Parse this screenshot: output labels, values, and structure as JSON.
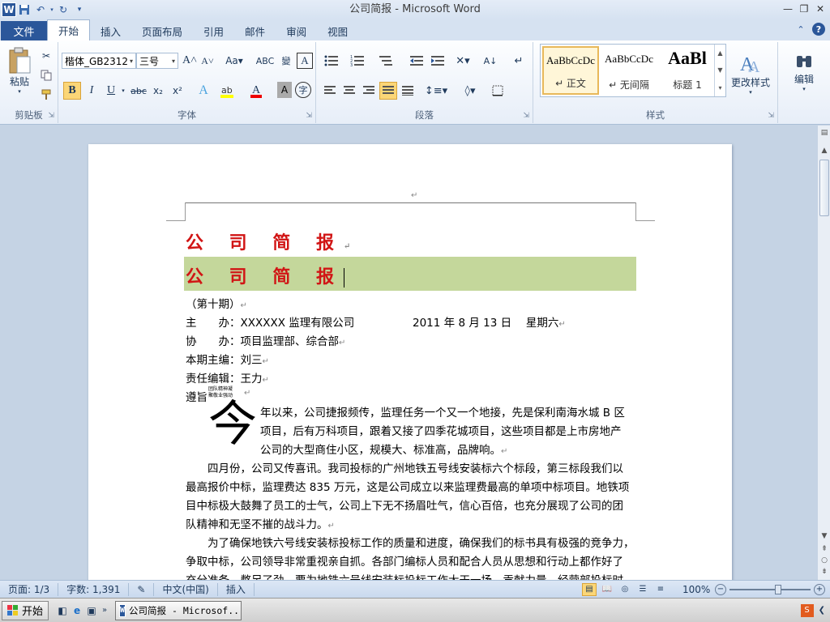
{
  "window": {
    "title": "公司简报 - Microsoft Word"
  },
  "qat": {
    "word_icon_letter": "W"
  },
  "tabs": [
    {
      "label": "文件"
    },
    {
      "label": "开始"
    },
    {
      "label": "插入"
    },
    {
      "label": "页面布局"
    },
    {
      "label": "引用"
    },
    {
      "label": "邮件"
    },
    {
      "label": "审阅"
    },
    {
      "label": "视图"
    }
  ],
  "ribbon": {
    "clipboard": {
      "paste": "粘贴",
      "label": "剪贴板"
    },
    "font": {
      "name": "楷体_GB2312",
      "size": "三号",
      "label": "字体"
    },
    "paragraph": {
      "label": "段落"
    },
    "styles": {
      "label": "样式",
      "items": [
        {
          "sample": "AaBbCcDc",
          "name": "↵ 正文"
        },
        {
          "sample": "AaBbCcDc",
          "name": "↵ 无间隔"
        },
        {
          "sample": "AaBl",
          "name": "标题 1"
        }
      ],
      "change": "更改样式"
    },
    "editing": {
      "label": "编辑"
    }
  },
  "document": {
    "title1": "公 司 简 报",
    "title2": "公 司 简 报",
    "issue": "（第十期）",
    "sponsor_label": "主　　办：",
    "sponsor": "XXXXXX 监理有限公司",
    "date": "2011 年 8 月  13 日",
    "weekday": "星期六",
    "co_label": "协　　办：",
    "co": "项目监理部、综合部",
    "chief_label": "本期主编：",
    "chief": "刘三",
    "editor_label": "责任编辑：",
    "editor": "王力",
    "motto_label": "遵旨",
    "motto_line1": "团队精神凝",
    "motto_line2": "聚敬业强动",
    "dropcap": "今",
    "p1_lines": [
      "年以来，公司捷报频传，监理任务一个又一个地接，先是保利南海水城 B 区",
      "项目，后有万科项目，跟着又接了四季花城项目，这些项目都是上市房地产",
      "公司的大型商住小区，规模大、标准高，品牌响。"
    ],
    "p2_lines": [
      "　　四月份，公司又传喜讯。我司投标的广州地铁五号线安装标六个标段，第三标段我们以",
      "最高报价中标，监理费达 835 万元，这是公司成立以来监理费最高的单项中标项目。地铁项",
      "目中标极大鼓舞了员工的士气，公司上下无不扬眉吐气，信心百倍，也充分展现了公司的团",
      "队精神和无坚不摧的战斗力。"
    ],
    "p3_lines": [
      "　　为了确保地铁六号线安装标投标工作的质量和进度，确保我们的标书具有极强的竞争力，",
      "争取中标，公司领导非常重视亲自抓。各部门编标人员和配合人员从思想和行动上都作好了",
      "充分准备，憋足了劲，要为地铁六号线安装标投标工作大干一场，贡献力量。经营部投标时"
    ]
  },
  "status": {
    "page": "页面: 1/3",
    "words": "字数: 1,391",
    "lang": "中文(中国)",
    "mode": "插入",
    "zoom": "100%",
    "zoom_level": 1.0
  },
  "taskbar": {
    "start": "开始",
    "task": "公司简报 - Microsof..."
  },
  "colors": {
    "title_red": "#d11515",
    "shade_green": "#c4d79b",
    "file_tab": "#2b579a"
  }
}
